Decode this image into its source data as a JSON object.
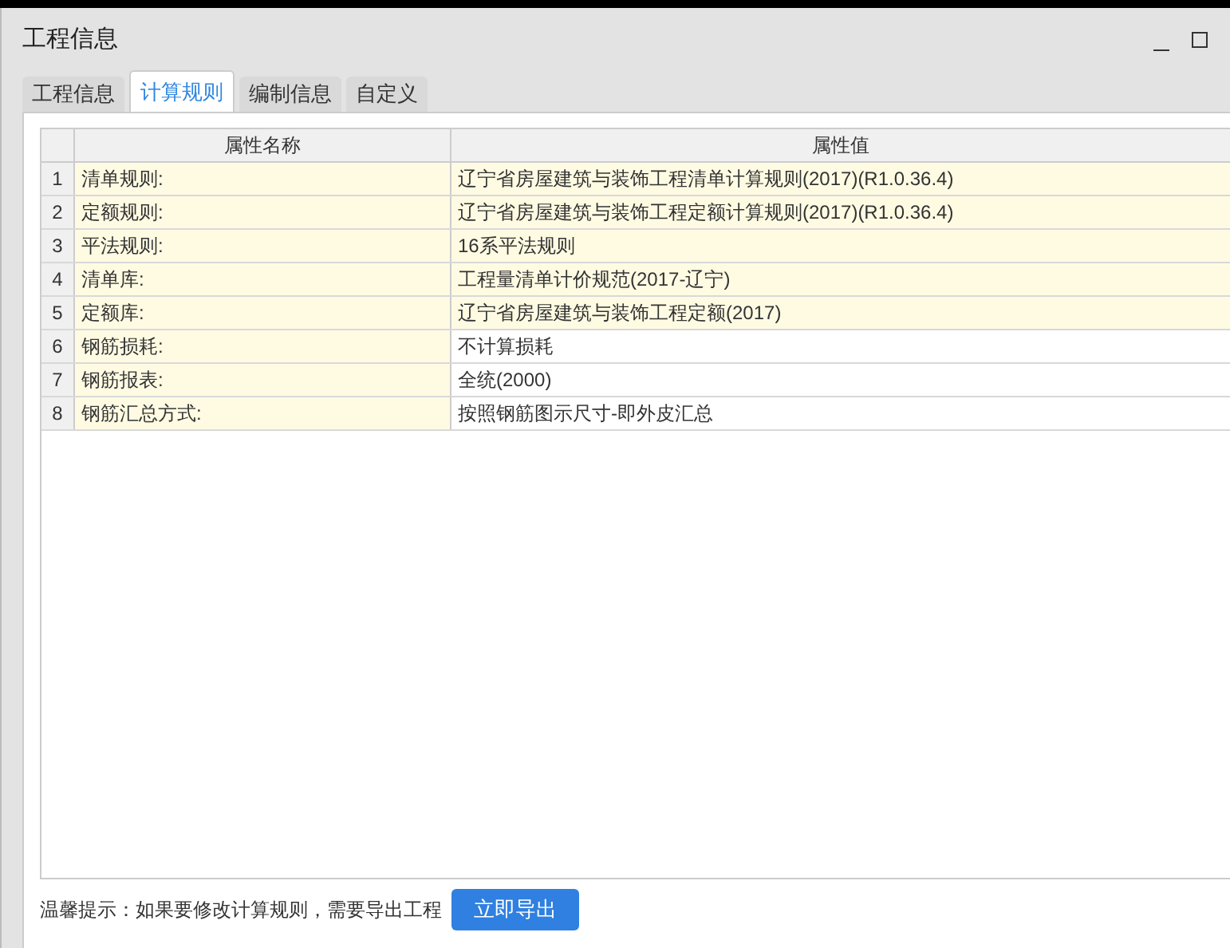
{
  "window": {
    "title": "工程信息"
  },
  "tabs": [
    {
      "label": "工程信息",
      "selected": false
    },
    {
      "label": "计算规则",
      "selected": true
    },
    {
      "label": "编制信息",
      "selected": false
    },
    {
      "label": "自定义",
      "selected": false
    }
  ],
  "table": {
    "columns": [
      "属性名称",
      "属性值"
    ],
    "rows": [
      {
        "index": "1",
        "name": "清单规则:",
        "value": "辽宁省房屋建筑与装饰工程清单计算规则(2017)(R1.0.36.4)",
        "highlighted": true
      },
      {
        "index": "2",
        "name": "定额规则:",
        "value": "辽宁省房屋建筑与装饰工程定额计算规则(2017)(R1.0.36.4)",
        "highlighted": true
      },
      {
        "index": "3",
        "name": "平法规则:",
        "value": "16系平法规则",
        "highlighted": true
      },
      {
        "index": "4",
        "name": "清单库:",
        "value": "工程量清单计价规范(2017-辽宁)",
        "highlighted": true
      },
      {
        "index": "5",
        "name": "定额库:",
        "value": "辽宁省房屋建筑与装饰工程定额(2017)",
        "highlighted": true
      },
      {
        "index": "6",
        "name": "钢筋损耗:",
        "value": "不计算损耗",
        "highlighted": false
      },
      {
        "index": "7",
        "name": "钢筋报表:",
        "value": "全统(2000)",
        "highlighted": false
      },
      {
        "index": "8",
        "name": "钢筋汇总方式:",
        "value": "按照钢筋图示尺寸-即外皮汇总",
        "highlighted": false
      }
    ]
  },
  "footer": {
    "hint": "温馨提示：如果要修改计算规则，需要导出工程",
    "button": "立即导出"
  }
}
